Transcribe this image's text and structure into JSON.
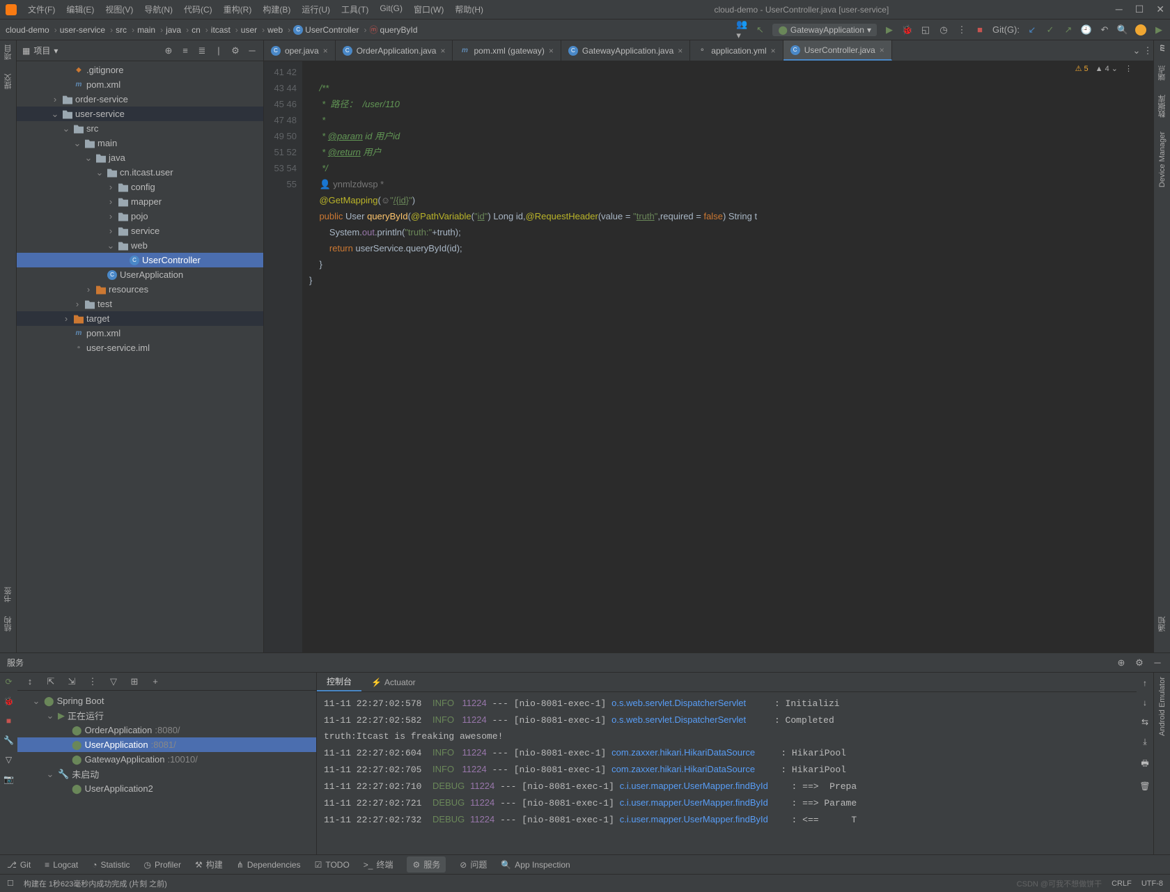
{
  "window": {
    "title": "cloud-demo - UserController.java [user-service]"
  },
  "menus": [
    "文件(F)",
    "编辑(E)",
    "视图(V)",
    "导航(N)",
    "代码(C)",
    "重构(R)",
    "构建(B)",
    "运行(U)",
    "工具(T)",
    "Git(G)",
    "窗口(W)",
    "帮助(H)"
  ],
  "breadcrumbs": [
    "cloud-demo",
    "user-service",
    "src",
    "main",
    "java",
    "cn",
    "itcast",
    "user",
    "web",
    "UserController",
    "queryById"
  ],
  "runconfig": "GatewayApplication",
  "git_label": "Git(G):",
  "project": {
    "panel_label": "项目",
    "root": [
      {
        "icon": "git",
        "label": ".gitignore",
        "indent": 4
      },
      {
        "icon": "m",
        "label": "pom.xml",
        "indent": 4
      },
      {
        "icon": "folder",
        "label": "order-service",
        "indent": 3,
        "caret": ">"
      },
      {
        "icon": "folder",
        "label": "user-service",
        "indent": 3,
        "caret": "v",
        "sel2": true
      },
      {
        "icon": "folder",
        "label": "src",
        "indent": 4,
        "caret": "v"
      },
      {
        "icon": "folder",
        "label": "main",
        "indent": 5,
        "caret": "v"
      },
      {
        "icon": "folder",
        "label": "java",
        "indent": 6,
        "caret": "v"
      },
      {
        "icon": "folder",
        "label": "cn.itcast.user",
        "indent": 7,
        "caret": "v"
      },
      {
        "icon": "folder",
        "label": "config",
        "indent": 8,
        "caret": ">"
      },
      {
        "icon": "folder",
        "label": "mapper",
        "indent": 8,
        "caret": ">"
      },
      {
        "icon": "folder",
        "label": "pojo",
        "indent": 8,
        "caret": ">"
      },
      {
        "icon": "folder",
        "label": "service",
        "indent": 8,
        "caret": ">"
      },
      {
        "icon": "folder",
        "label": "web",
        "indent": 8,
        "caret": "v"
      },
      {
        "icon": "c",
        "label": "UserController",
        "indent": 9,
        "sel": true
      },
      {
        "icon": "c",
        "label": "UserApplication",
        "indent": 7
      },
      {
        "icon": "folder-or",
        "label": "resources",
        "indent": 6,
        "caret": ">"
      },
      {
        "icon": "folder",
        "label": "test",
        "indent": 5,
        "caret": ">"
      },
      {
        "icon": "folder-or",
        "label": "target",
        "indent": 4,
        "caret": ">",
        "sel2": true
      },
      {
        "icon": "m",
        "label": "pom.xml",
        "indent": 4
      },
      {
        "icon": "file",
        "label": "user-service.iml",
        "indent": 4
      }
    ]
  },
  "tabs": [
    {
      "label": "oper.java",
      "icon": "c",
      "partial": true
    },
    {
      "label": "OrderApplication.java",
      "icon": "c"
    },
    {
      "label": "pom.xml (gateway)",
      "icon": "m"
    },
    {
      "label": "GatewayApplication.java",
      "icon": "c"
    },
    {
      "label": "application.yml",
      "icon": "y"
    },
    {
      "label": "UserController.java",
      "icon": "c",
      "active": true
    }
  ],
  "indicators": {
    "warn": "5",
    "up": "4"
  },
  "code": {
    "start": 41,
    "end": 55,
    "author": "ynmlzdwsp *",
    "lines": [
      "",
      "    <span class='doc'>/**</span>",
      "    <span class='doc'> *  路径：  /user/110</span>",
      "    <span class='doc'> *</span>",
      "    <span class='doc'> * <span class='tag'>@param</span> id 用户id</span>",
      "    <span class='doc'> * <span class='tag'>@return</span> 用户</span>",
      "    <span class='doc'> */</span>",
      "    <span class='a'>@GetMapping</span>(<span style='color:#888'>☺</span><span class='s'>\"<u>/{id}</u>\"</span>)",
      "    <span class='k'>public</span> User <span style='color:#ffc66d'>queryById</span>(<span class='a'>@PathVariable</span>(<span class='s'>\"<u>id</u>\"</span>) Long id,<span class='a'>@RequestHeader</span>(value = <span class='s'>\"<u>truth</u>\"</span>,required = <span class='k'>false</span>) String t",
      "        System.<span class='f'>out</span>.println(<span class='s'>\"truth:\"</span>+truth);",
      "        <span class='k'>return</span> userService.queryById(id);",
      "    }",
      "}",
      ""
    ]
  },
  "services": {
    "label": "服务",
    "toolbar_icons": [
      "↕",
      "⇱",
      "⇲",
      "⋮",
      "▽",
      "⊞",
      "+"
    ],
    "tree": [
      {
        "label": "Spring Boot",
        "icon": "sb",
        "indent": 0,
        "caret": "v"
      },
      {
        "label": "正在运行",
        "icon": "play",
        "indent": 1,
        "caret": "v"
      },
      {
        "label": "OrderApplication",
        "port": ":8080/",
        "icon": "sb",
        "indent": 2
      },
      {
        "label": "UserApplication",
        "port": ":8081/",
        "icon": "sb",
        "indent": 2,
        "sel": true
      },
      {
        "label": "GatewayApplication",
        "port": ":10010/",
        "icon": "sb",
        "indent": 2
      },
      {
        "label": "未启动",
        "icon": "wrench",
        "indent": 1,
        "caret": "v"
      },
      {
        "label": "UserApplication2",
        "icon": "sb",
        "indent": 2
      }
    ],
    "console_tabs": [
      "控制台",
      "Actuator"
    ],
    "console": [
      {
        "ts": "11-11 22:27:02:578",
        "lvl": "INFO",
        "pid": "11224",
        "thr": "[nio-8081-exec-1]",
        "cls": "o.s.web.servlet.DispatcherServlet",
        "msg": ": Initializi"
      },
      {
        "ts": "11-11 22:27:02:582",
        "lvl": "INFO",
        "pid": "11224",
        "thr": "[nio-8081-exec-1]",
        "cls": "o.s.web.servlet.DispatcherServlet",
        "msg": ": Completed "
      },
      {
        "raw": "truth:Itcast is freaking awesome!"
      },
      {
        "ts": "11-11 22:27:02:604",
        "lvl": "INFO",
        "pid": "11224",
        "thr": "[nio-8081-exec-1]",
        "cls": "com.zaxxer.hikari.HikariDataSource",
        "msg": ": HikariPool"
      },
      {
        "ts": "11-11 22:27:02:705",
        "lvl": "INFO",
        "pid": "11224",
        "thr": "[nio-8081-exec-1]",
        "cls": "com.zaxxer.hikari.HikariDataSource",
        "msg": ": HikariPool"
      },
      {
        "ts": "11-11 22:27:02:710",
        "lvl": "DEBUG",
        "pid": "11224",
        "thr": "[nio-8081-exec-1]",
        "cls": "c.i.user.mapper.UserMapper.findById",
        "msg": ": ==>  Prepa"
      },
      {
        "ts": "11-11 22:27:02:721",
        "lvl": "DEBUG",
        "pid": "11224",
        "thr": "[nio-8081-exec-1]",
        "cls": "c.i.user.mapper.UserMapper.findById",
        "msg": ": ==> Parame"
      },
      {
        "ts": "11-11 22:27:02:732",
        "lvl": "DEBUG",
        "pid": "11224",
        "thr": "[nio-8081-exec-1]",
        "cls": "c.i.user.mapper.UserMapper.findById",
        "msg": ": <==      T"
      }
    ]
  },
  "bottombar": [
    {
      "icon": "⎇",
      "label": "Git"
    },
    {
      "icon": "≡",
      "label": "Logcat"
    },
    {
      "icon": "◔",
      "label": "Statistic"
    },
    {
      "icon": "◷",
      "label": "Profiler"
    },
    {
      "icon": "⚒",
      "label": "构建"
    },
    {
      "icon": "⋔",
      "label": "Dependencies"
    },
    {
      "icon": "☑",
      "label": "TODO"
    },
    {
      "icon": ">_",
      "label": "终端"
    },
    {
      "icon": "⚙",
      "label": "服务",
      "active": true
    },
    {
      "icon": "⊘",
      "label": "问题"
    },
    {
      "icon": "🔍",
      "label": "App Inspection"
    }
  ],
  "status": {
    "msg": "构建在 1秒623毫秒内成功完成 (片刻 之前)",
    "right": [
      "CRLF",
      "UTF-8"
    ],
    "watermark": "CSDN @可我不想做饼干"
  },
  "left_tabs": [
    "项目",
    "提交"
  ],
  "left_tabs2": [
    "书签",
    "结构"
  ],
  "right_tabs": [
    "Maven",
    "端点",
    "数据库",
    "Device Manager",
    "通知"
  ]
}
